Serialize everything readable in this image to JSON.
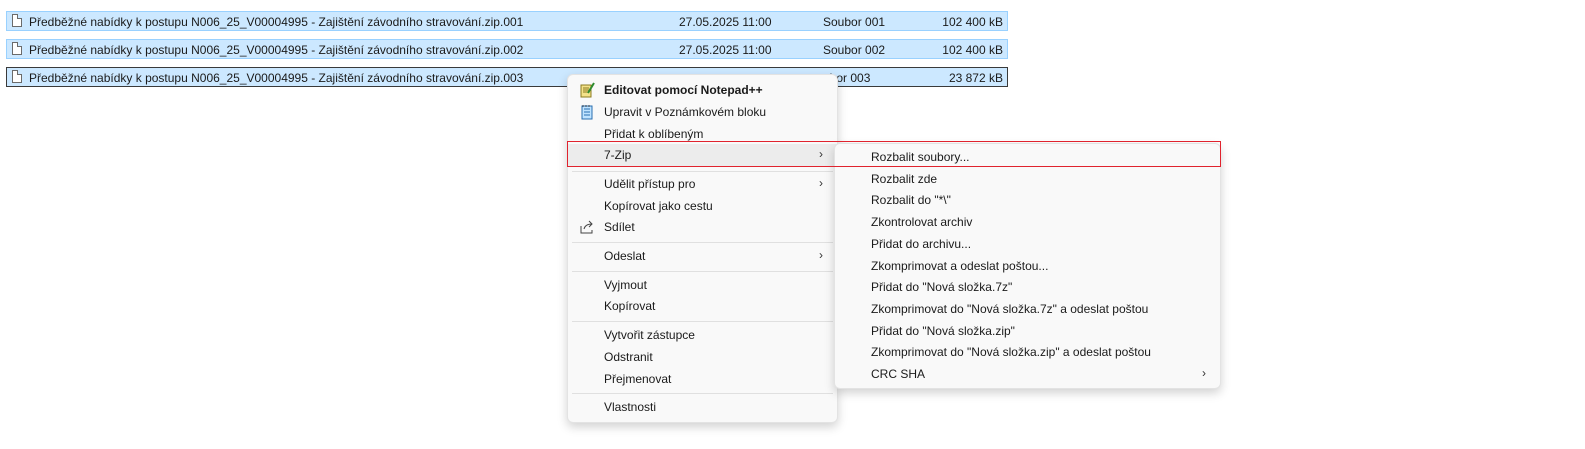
{
  "files": [
    {
      "name": "Předběžné nabídky k postupu N006_25_V00004995 - Zajištění závodního stravování.zip.001",
      "date": "27.05.2025 11:00",
      "type": "Soubor 001",
      "size": "102 400 kB"
    },
    {
      "name": "Předběžné nabídky k postupu N006_25_V00004995 - Zajištění závodního stravování.zip.002",
      "date": "27.05.2025 11:00",
      "type": "Soubor 002",
      "size": "102 400 kB"
    },
    {
      "name": "Předběžné nabídky k postupu N006_25_V00004995 - Zajištění závodního stravování.zip.003",
      "date": "",
      "type": "ubor 003",
      "size": "23 872 kB"
    }
  ],
  "context_menu": {
    "items": [
      {
        "label": "Editovat pomocí Notepad++",
        "icon": "notepad-plus-icon"
      },
      {
        "label": "Upravit v Poznámkovém bloku",
        "icon": "notepad-icon"
      },
      {
        "label": "Přidat k oblíbeným"
      },
      {
        "label": "7-Zip",
        "submenu": true
      },
      {
        "label": "Udělit přístup pro",
        "submenu": true
      },
      {
        "label": "Kopírovat jako cestu"
      },
      {
        "label": "Sdílet",
        "icon": "share-icon"
      },
      {
        "label": "Odeslat",
        "submenu": true
      },
      {
        "label": "Vyjmout"
      },
      {
        "label": "Kopírovat"
      },
      {
        "label": "Vytvořit zástupce"
      },
      {
        "label": "Odstranit"
      },
      {
        "label": "Přejmenovat"
      },
      {
        "label": "Vlastnosti"
      }
    ],
    "arrow": "›"
  },
  "sevenzip_menu": {
    "items": [
      {
        "label": "Rozbalit soubory..."
      },
      {
        "label": "Rozbalit zde"
      },
      {
        "label": "Rozbalit do \"*\\\""
      },
      {
        "label": "Zkontrolovat archiv"
      },
      {
        "label": "Přidat do archivu..."
      },
      {
        "label": "Zkomprimovat a odeslat poštou..."
      },
      {
        "label": "Přidat do \"Nová složka.7z\""
      },
      {
        "label": "Zkomprimovat do \"Nová složka.7z\" a odeslat poštou"
      },
      {
        "label": "Přidat do \"Nová složka.zip\""
      },
      {
        "label": "Zkomprimovat do \"Nová složka.zip\" a odeslat poštou"
      },
      {
        "label": "CRC SHA",
        "submenu": true
      }
    ]
  },
  "colors": {
    "selection": "#cce8ff",
    "highlight_border": "#e0232e"
  }
}
